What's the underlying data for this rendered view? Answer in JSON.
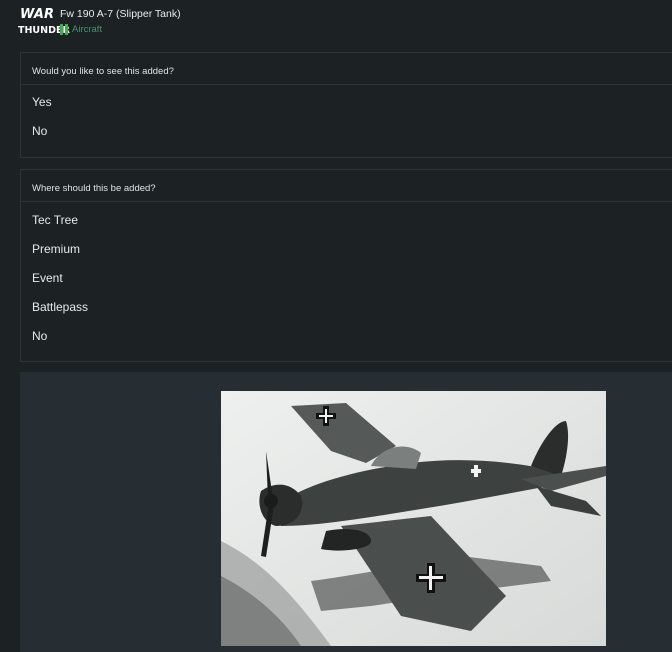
{
  "header": {
    "logo_line1": "WAR",
    "logo_line2": "THUNDER",
    "title": "Fw 190 A-7 (Slipper Tank)",
    "category": "Aircraft",
    "category_color": "#3fae49"
  },
  "polls": [
    {
      "question": "Would you like to see this added?",
      "options": [
        "Yes",
        "No"
      ]
    },
    {
      "question": "Where should this be added?",
      "options": [
        "Tec Tree",
        "Premium",
        "Event",
        "Battlepass",
        "No"
      ]
    }
  ],
  "colors": {
    "background": "#1c2124",
    "panel": "#262e33",
    "border": "#2e3539"
  },
  "photo": {
    "icon": "aircraft-photo",
    "subject": "black-and-white photo of Fw 190 aircraft"
  }
}
